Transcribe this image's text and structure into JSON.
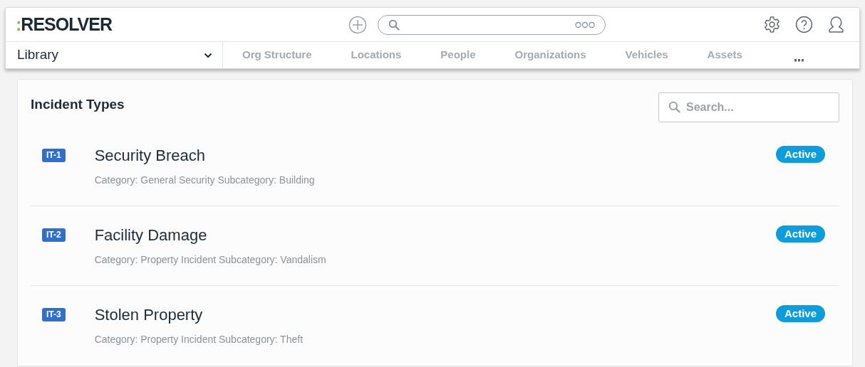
{
  "logo": ":RESOLVER",
  "nav": {
    "dropdown": "Library",
    "tabs": [
      {
        "label": "Org Structure",
        "selected": false
      },
      {
        "label": "Locations",
        "selected": false
      },
      {
        "label": "People",
        "selected": false
      },
      {
        "label": "Organizations",
        "selected": false
      },
      {
        "label": "Vehicles",
        "selected": false
      },
      {
        "label": "Assets",
        "selected": false
      }
    ]
  },
  "panel": {
    "title": "Incident Types",
    "search": {
      "placeholder": "Search..."
    },
    "items": [
      {
        "id": "IT-1",
        "name": "Security Breach",
        "details": "Category: General Security Subcategory: Building",
        "status": "Active"
      },
      {
        "id": "IT-2",
        "name": "Facility Damage",
        "details": "Category: Property Incident Subcategory: Vandalism",
        "status": "Active"
      },
      {
        "id": "IT-3",
        "name": "Stolen Property",
        "details": "Category: Property Incident Subcategory: Theft",
        "status": "Active"
      }
    ]
  }
}
